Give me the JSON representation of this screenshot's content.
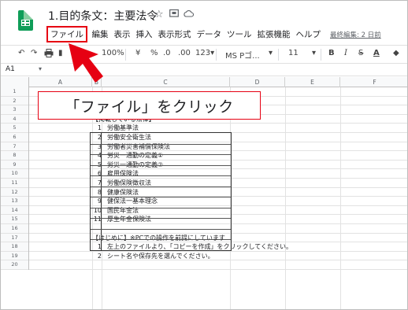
{
  "app": {
    "doc_title": "1.目的条文：主要法令",
    "title_icons": [
      "star-icon",
      "folder-icon",
      "cloud-icon"
    ]
  },
  "menu": {
    "items": [
      "ファイル",
      "編集",
      "表示",
      "挿入",
      "表示形式",
      "データ",
      "ツール",
      "拡張機能",
      "ヘルプ"
    ],
    "last_edit": "最終編集: 2 日前"
  },
  "toolbar": {
    "zoom": "100%",
    "currency": "¥",
    "percent": "%",
    "dec_decrease": ".0",
    "dec_increase": ".00",
    "format_more": "123▾",
    "font": "MS Pゴ...",
    "font_size": "11",
    "bold": "B",
    "italic": "I",
    "strike": "S",
    "text_color": "A"
  },
  "formula_bar": {
    "name_box": "A1"
  },
  "columns": [
    "A",
    "B",
    "C",
    "D",
    "E",
    "F"
  ],
  "rows": [
    "1",
    "2",
    "3",
    "4",
    "5",
    "6",
    "7",
    "8",
    "9",
    "10",
    "11",
    "12",
    "13",
    "14",
    "15",
    "16",
    "17",
    "18",
    "19",
    "20"
  ],
  "callout": {
    "text": "「ファイル」をクリック"
  },
  "sheet": {
    "section_title": "【掲載している法律】",
    "laws": [
      {
        "num": "1",
        "name": "労働基準法"
      },
      {
        "num": "2",
        "name": "労働安全衛生法"
      },
      {
        "num": "3",
        "name": "労働者災害補償保険法"
      },
      {
        "num": "4",
        "name": "労災一通勤の定義①"
      },
      {
        "num": "5",
        "name": "労災一通勤の定義②"
      },
      {
        "num": "6",
        "name": "雇用保険法"
      },
      {
        "num": "7",
        "name": "労働保険徴収法"
      },
      {
        "num": "8",
        "name": "健康保険法"
      },
      {
        "num": "9",
        "name": "健保法一基本理念"
      },
      {
        "num": "10",
        "name": "国民年金法"
      },
      {
        "num": "11",
        "name": "厚生年金保険法"
      }
    ],
    "intro_title": "【はじめに】※PCでの操作を前提にしています",
    "steps": [
      {
        "num": "1",
        "text": "左上のファイルより、「コピーを作成」をクリックしてください。"
      },
      {
        "num": "2",
        "text": "シート名や保存先を選んでください。"
      }
    ]
  },
  "colors": {
    "accent_red": "#e60012",
    "sheets_green": "#0f9d58"
  }
}
